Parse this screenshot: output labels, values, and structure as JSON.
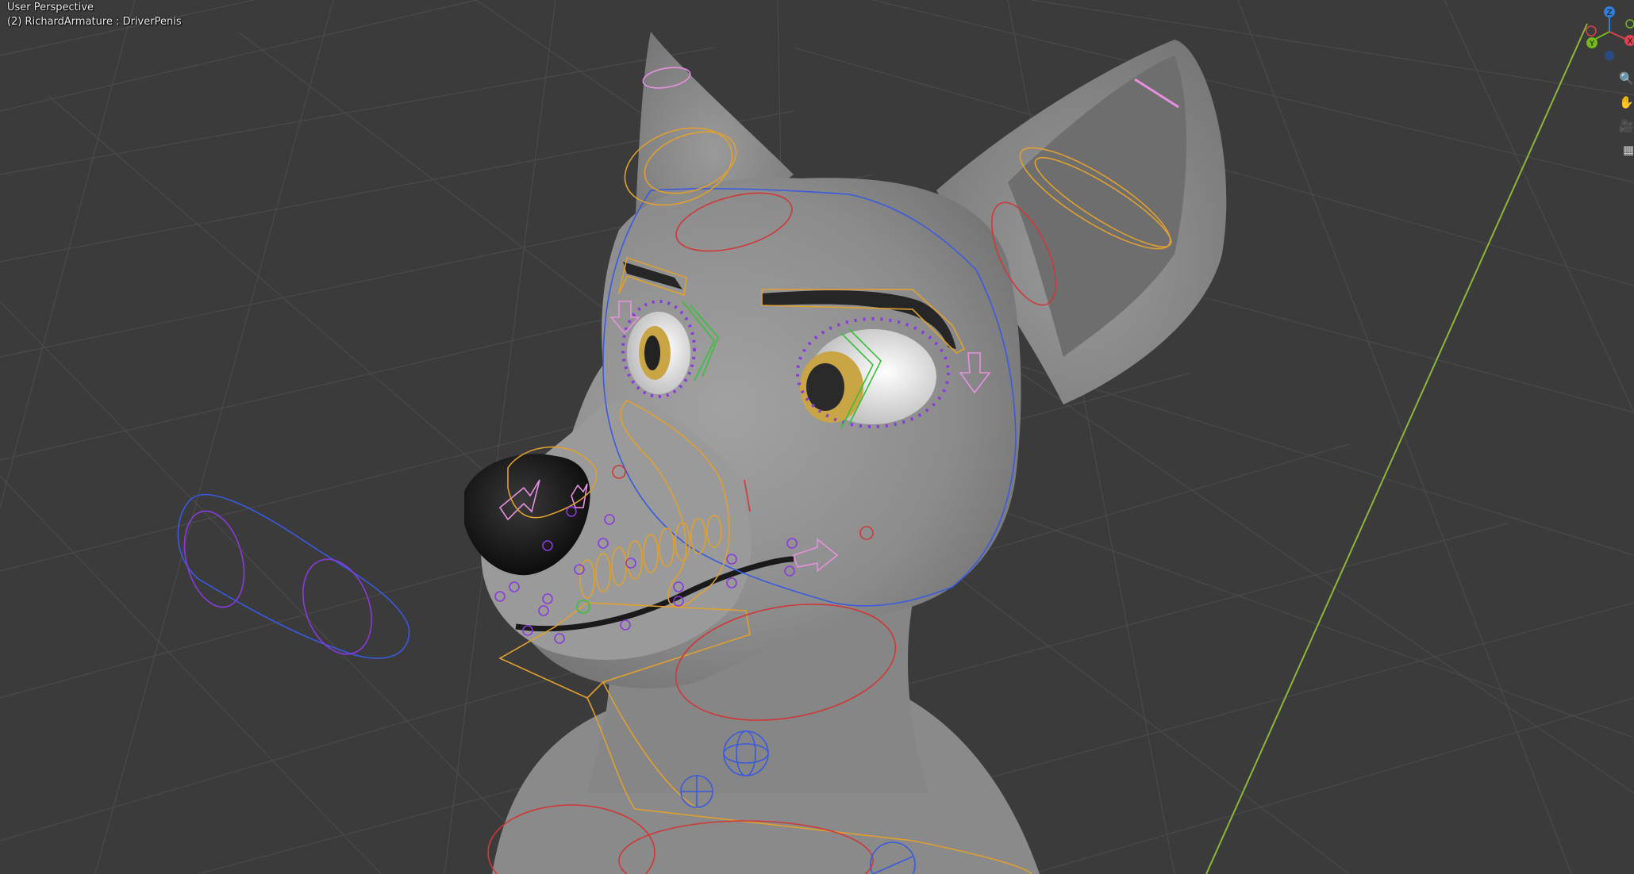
{
  "viewport": {
    "view_label": "User Perspective",
    "object_label": "(2) RichardArmature : DriverPenis",
    "background": "#3b3b3b",
    "grid_color": "#4a4a4a",
    "x_axis_color": "#c05050",
    "y_axis_color": "#8ab83a",
    "mesh_color": "#8a8a8a"
  },
  "gizmo": {
    "z_label": "Z",
    "x_label": "X",
    "y_label": "Y",
    "z_color": "#2f7fd8",
    "x_color": "#e0404f",
    "y_color": "#74b81e"
  },
  "nav_tools": [
    {
      "icon": "zoom-icon",
      "glyph": "🔍"
    },
    {
      "icon": "hand-pan-icon",
      "glyph": "✋"
    },
    {
      "icon": "camera-icon",
      "glyph": "🎥"
    },
    {
      "icon": "grid-ortho-icon",
      "glyph": "▦"
    }
  ],
  "rig_colors": {
    "yellow": "#e0a030",
    "red": "#d03838",
    "blue": "#3a5ae0",
    "purple": "#8a3adc",
    "green": "#38c038",
    "pink": "#e890e0"
  }
}
